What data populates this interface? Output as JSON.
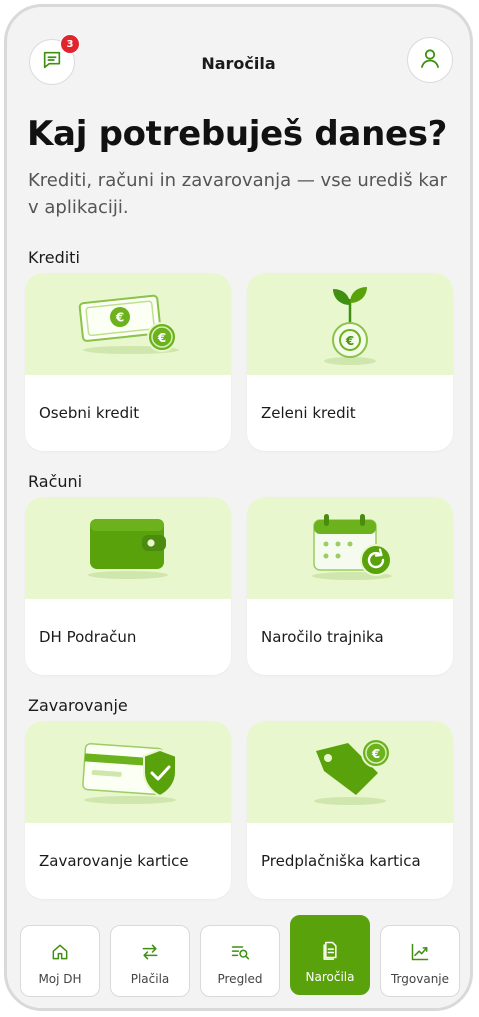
{
  "header": {
    "title": "Naročila",
    "notifications_count": "3"
  },
  "hero": {
    "title": "Kaj potrebuješ danes?",
    "subtitle": "Krediti, računi in zavarovanja — vse urediš kar v aplikaciji."
  },
  "sections": [
    {
      "label": "Krediti",
      "cards": [
        {
          "label": "Osebni kredit",
          "icon": "banknote-coin-icon"
        },
        {
          "label": "Zeleni kredit",
          "icon": "sprout-coin-icon"
        }
      ]
    },
    {
      "label": "Računi",
      "cards": [
        {
          "label": "DH Podračun",
          "icon": "wallet-icon"
        },
        {
          "label": "Naročilo trajnika",
          "icon": "calendar-recurring-icon"
        }
      ]
    },
    {
      "label": "Zavarovanje",
      "cards": [
        {
          "label": "Zavarovanje kartice",
          "icon": "card-shield-icon"
        },
        {
          "label": "Predplačniška kartica",
          "icon": "price-tag-coin-icon"
        }
      ]
    }
  ],
  "nav": [
    {
      "label": "Moj DH",
      "icon": "home-icon"
    },
    {
      "label": "Plačila",
      "icon": "transfer-arrows-icon"
    },
    {
      "label": "Pregled",
      "icon": "search-list-icon"
    },
    {
      "label": "Naročila",
      "icon": "document-icon",
      "active": true
    },
    {
      "label": "Trgovanje",
      "icon": "trend-chart-icon"
    }
  ],
  "colors": {
    "accent": "#5aa20b",
    "card_art_bg": "#e9f7cf",
    "badge": "#e0262d"
  }
}
